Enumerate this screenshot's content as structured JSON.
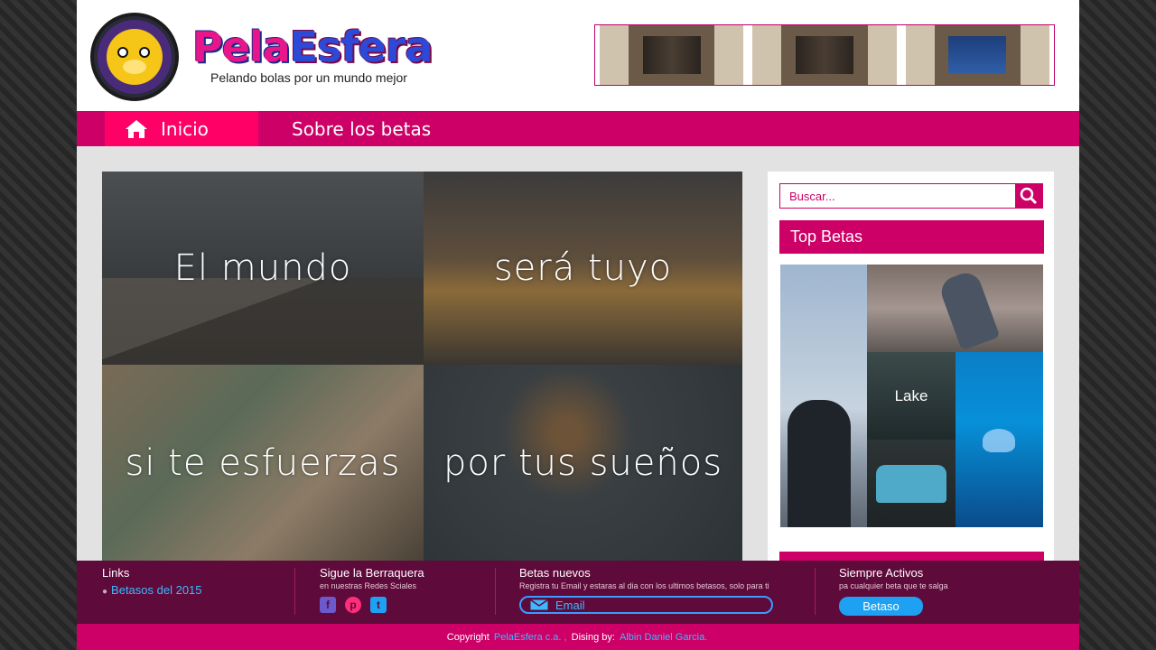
{
  "brand": {
    "title_part1": "Pela",
    "title_part2": "Esfera",
    "tagline": "Pelando bolas por un mundo mejor"
  },
  "nav": {
    "home_label": "Inicio",
    "about_label": "Sobre los betas"
  },
  "hero": {
    "tiles": [
      "El mundo",
      "será tuyo",
      "si te esfuerzas",
      "por tus sueños"
    ]
  },
  "sidebar": {
    "search_placeholder": "Buscar...",
    "top_title": "Top Betas",
    "gallery_label": "Lake"
  },
  "footer": {
    "links": {
      "title": "Links",
      "item": "Betasos del 2015"
    },
    "social": {
      "title": "Sigue la Berraquera",
      "subtitle": "en nuestras Redes Sciales"
    },
    "newsletter": {
      "title": "Betas nuevos",
      "subtitle": "Registra tu Email y estaras al dia con los ultimos betasos, solo para ti",
      "email_placeholder": "Email"
    },
    "active": {
      "title": "Siempre Activos",
      "subtitle": "pa cualquier beta que te salga",
      "button": "Betaso"
    }
  },
  "copyright": {
    "prefix": "Copyright",
    "site": "PelaEsfera c.a. ,",
    "middle": "Dising by:",
    "author": "Albin Daniel Garcia."
  },
  "colors": {
    "brand": "#cc0066",
    "nav_active": "#ff0066",
    "footer_bg": "#5e0a3a",
    "link": "#3fb8ff"
  }
}
